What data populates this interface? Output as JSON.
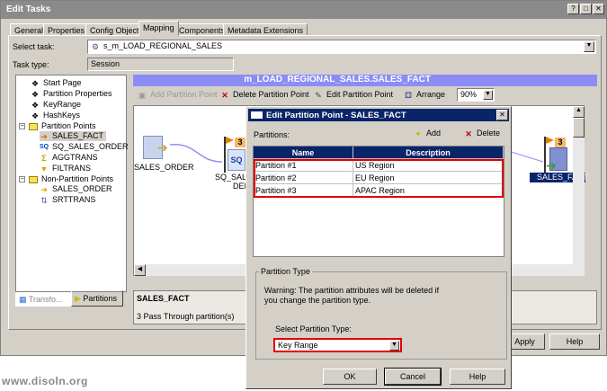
{
  "window": {
    "title": "Edit Tasks",
    "controls": [
      "?",
      "□",
      "✕"
    ]
  },
  "tabs": [
    "General",
    "Properties",
    "Config Object",
    "Mapping",
    "Components",
    "Metadata Extensions"
  ],
  "active_tab": "Mapping",
  "select_task": {
    "label": "Select task:",
    "value": "s_m_LOAD_REGIONAL_SALES"
  },
  "task_type": {
    "label": "Task type:",
    "value": "Session"
  },
  "tree": {
    "items": [
      "Start Page",
      "Partition Properties",
      "KeyRange",
      "HashKeys"
    ],
    "partition_points": {
      "label": "Partition Points",
      "items": [
        "SALES_FACT",
        "SQ_SALES_ORDER",
        "AGGTRANS",
        "FILTRANS"
      ]
    },
    "non_partition_points": {
      "label": "Non-Partition Points",
      "items": [
        "SALES_ORDER",
        "SRTTRANS"
      ]
    }
  },
  "left_tabs": [
    "Transfo...",
    "Partitions"
  ],
  "mapping_header": "m_LOAD_REGIONAL_SALES.SALES_FACT",
  "toolbar": {
    "add": "Add Partition Point",
    "delete": "Delete Partition Point",
    "edit": "Edit Partition Point",
    "arrange": "Arrange",
    "zoom": "90%"
  },
  "canvas": {
    "source": "SALES_ORDER",
    "sq": "SQ_SALES_ORDER",
    "sq_line1": "SQ_SALE",
    "sq_line2": "DER",
    "target": "SALES_FACT",
    "badge": "3"
  },
  "info": {
    "title": "SALES_FACT",
    "detail": "3 Pass Through partition(s)"
  },
  "main_buttons": {
    "apply": "Apply",
    "help": "Help"
  },
  "dialog": {
    "title": "Edit Partition Point - SALES_FACT",
    "partitions_label": "Partitions:",
    "add": "Add",
    "delete": "Delete",
    "columns": [
      "Name",
      "Description"
    ],
    "rows": [
      [
        "Partition #1",
        "US Region"
      ],
      [
        "Partition #2",
        "EU Region"
      ],
      [
        "Partition #3",
        "APAC Region"
      ]
    ],
    "group_label": "Partition Type",
    "warning_line1": "Warning: The partition attributes will be deleted if",
    "warning_line2": "you change the partition type.",
    "select_label": "Select Partition Type:",
    "select_value": "Key Range",
    "ok": "OK",
    "cancel": "Cancel",
    "help": "Help"
  },
  "watermark": "www.disoln.org",
  "colors": {
    "highlight": "#e00000",
    "navy": "#0a246a",
    "header": "#8c8cf4"
  }
}
